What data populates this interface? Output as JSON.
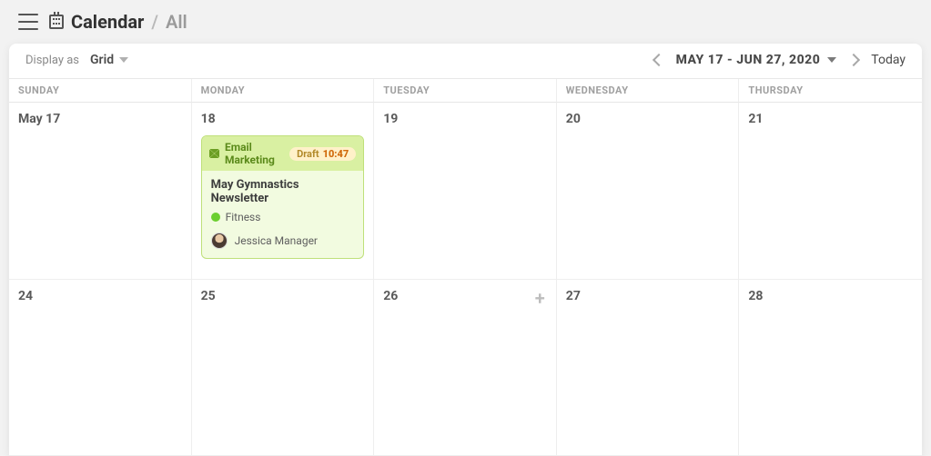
{
  "header": {
    "title": "Calendar",
    "separator": "/",
    "subtitle": "All"
  },
  "toolbar": {
    "display_as_label": "Display as",
    "display_as_value": "Grid",
    "date_range": "MAY 17 - JUN 27, 2020",
    "today_label": "Today"
  },
  "weekdays": [
    "SUNDAY",
    "MONDAY",
    "TUESDAY",
    "WEDNESDAY",
    "THURSDAY"
  ],
  "weeks": [
    {
      "days": [
        {
          "label": "May 17"
        },
        {
          "label": "18"
        },
        {
          "label": "19"
        },
        {
          "label": "20"
        },
        {
          "label": "21"
        }
      ]
    },
    {
      "days": [
        {
          "label": "24"
        },
        {
          "label": "25"
        },
        {
          "label": "26",
          "show_add": true
        },
        {
          "label": "27"
        },
        {
          "label": "28"
        }
      ]
    }
  ],
  "event": {
    "channel": "Email Marketing",
    "status": "Draft",
    "time": "10:47",
    "title": "May Gymnastics Newsletter",
    "tag": "Fitness",
    "owner": "Jessica Manager"
  }
}
